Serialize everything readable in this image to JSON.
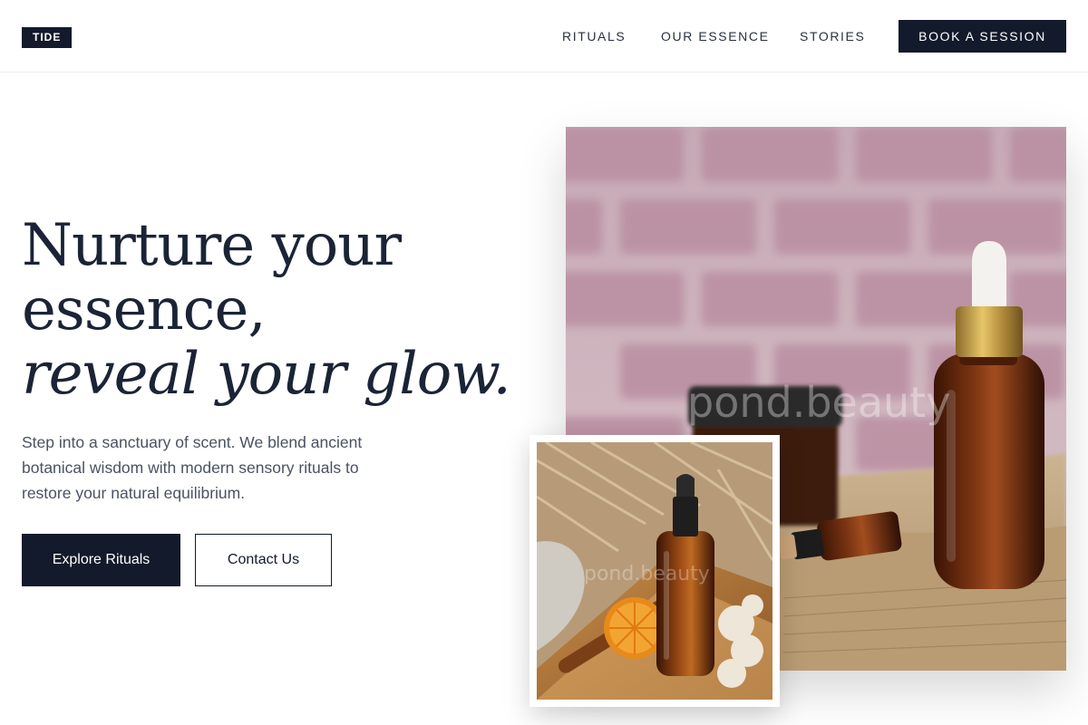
{
  "header": {
    "logo": "TIDE",
    "nav": [
      "RITUALS",
      "OUR ESSENCE",
      "STORIES"
    ],
    "cta_label": "BOOK A SESSION"
  },
  "hero": {
    "headline_line1": "Nurture your",
    "headline_line2": "essence,",
    "headline_line3": "reveal your glow.",
    "description": "Step into a sanctuary of scent. We blend ancient botanical wisdom with modern sensory rituals to restore your natural equilibrium.",
    "primary_button": "Explore Rituals",
    "secondary_button": "Contact Us"
  },
  "images": {
    "main_watermark": "pond.beauty",
    "inset_watermark": "pond.beauty"
  },
  "colors": {
    "brand_dark": "#121a2b",
    "headline": "#1b2436",
    "body_text": "#4b5263"
  }
}
